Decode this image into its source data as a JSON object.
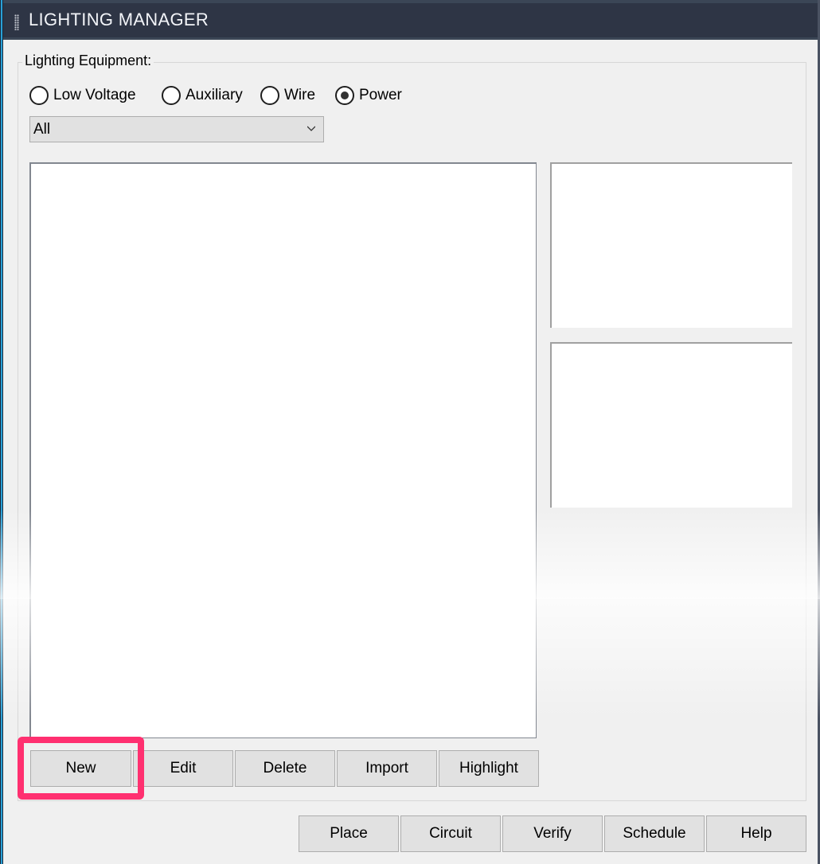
{
  "window": {
    "title": "LIGHTING MANAGER"
  },
  "equipment_group": {
    "label": "Lighting Equipment:",
    "radios": [
      {
        "label": "Low Voltage",
        "checked": false
      },
      {
        "label": "Auxiliary",
        "checked": false
      },
      {
        "label": "Wire",
        "checked": false
      },
      {
        "label": "Power",
        "checked": true
      }
    ],
    "filter": {
      "selected": "All"
    }
  },
  "list_actions": [
    "New",
    "Edit",
    "Delete",
    "Import",
    "Highlight"
  ],
  "highlighted_button": "New",
  "footer_actions": [
    "Place",
    "Circuit",
    "Verify",
    "Schedule",
    "Help"
  ],
  "colors": {
    "titlebar": "#2e3545",
    "highlight": "#ff3070",
    "button_bg": "#e1e1e1"
  }
}
